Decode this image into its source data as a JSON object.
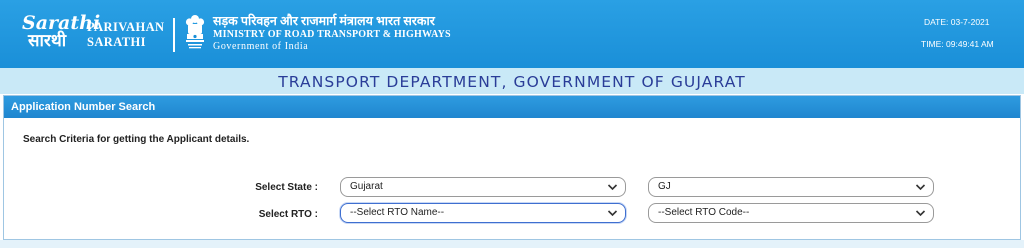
{
  "header": {
    "logo_line1": "Sarathi",
    "logo_line2": "सारथी",
    "brand_line1": "PARIVAHAN",
    "brand_line2": "SARATHI",
    "ministry_hindi": "सड़क परिवहन और राजमार्ग मंत्रालय भारत सरकार",
    "ministry_english": "MINISTRY OF ROAD TRANSPORT & HIGHWAYS",
    "government": "Government of India",
    "date_text": "DATE: 03-7-2021",
    "time_text": "TIME: 09:49:41 AM"
  },
  "department": {
    "title": "TRANSPORT DEPARTMENT, GOVERNMENT OF GUJARAT"
  },
  "panel": {
    "heading": "Application Number Search",
    "criteria_text": "Search Criteria for getting the Applicant details.",
    "state_label": "Select State :",
    "rto_label": "Select RTO :",
    "state_value": "Gujarat",
    "state_code_value": "GJ",
    "rto_name_value": "--Select RTO Name--",
    "rto_code_value": "--Select RTO Code--"
  },
  "colors": {
    "header_blue": "#1a8fd8",
    "title_navy": "#2a3d98",
    "band_light": "#c9e9f7"
  },
  "icons": [
    "sarathi-logo",
    "national-emblem-icon",
    "chevron-down-icon"
  ]
}
